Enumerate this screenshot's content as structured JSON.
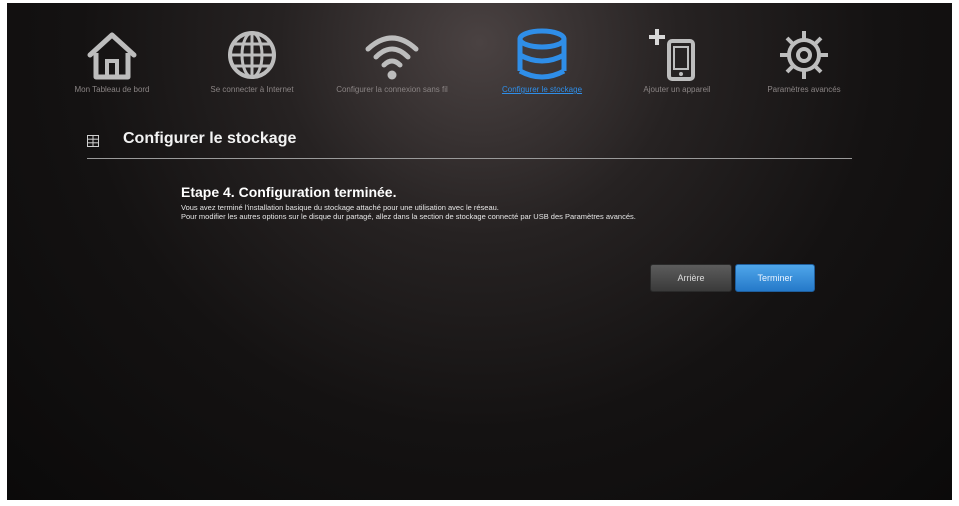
{
  "nav": {
    "items": [
      {
        "label": "Mon Tableau de bord",
        "icon": "home-icon",
        "active": false
      },
      {
        "label": "Se connecter à Internet",
        "icon": "globe-icon",
        "active": false
      },
      {
        "label": "Configurer la connexion sans fil",
        "icon": "wifi-icon",
        "active": false
      },
      {
        "label": "Configurer le stockage",
        "icon": "storage-icon",
        "active": true
      },
      {
        "label": "Ajouter un appareil",
        "icon": "add-device-icon",
        "active": false
      },
      {
        "label": "Paramètres avancés",
        "icon": "gear-icon",
        "active": false
      }
    ]
  },
  "section": {
    "title": "Configurer le stockage"
  },
  "step": {
    "title": "Etape 4. Configuration terminée.",
    "line1": "Vous avez terminé l'installation basique du stockage attaché pour une utilisation avec le réseau.",
    "line2": "Pour modifier les autres options sur le disque dur partagé, allez dans la section de stockage connecté par USB des Paramètres avancés."
  },
  "buttons": {
    "back": "Arrière",
    "finish": "Terminer"
  },
  "colors": {
    "accent": "#2f8ee8",
    "icon_inactive": "#bdbdbd",
    "background": "#141212"
  }
}
